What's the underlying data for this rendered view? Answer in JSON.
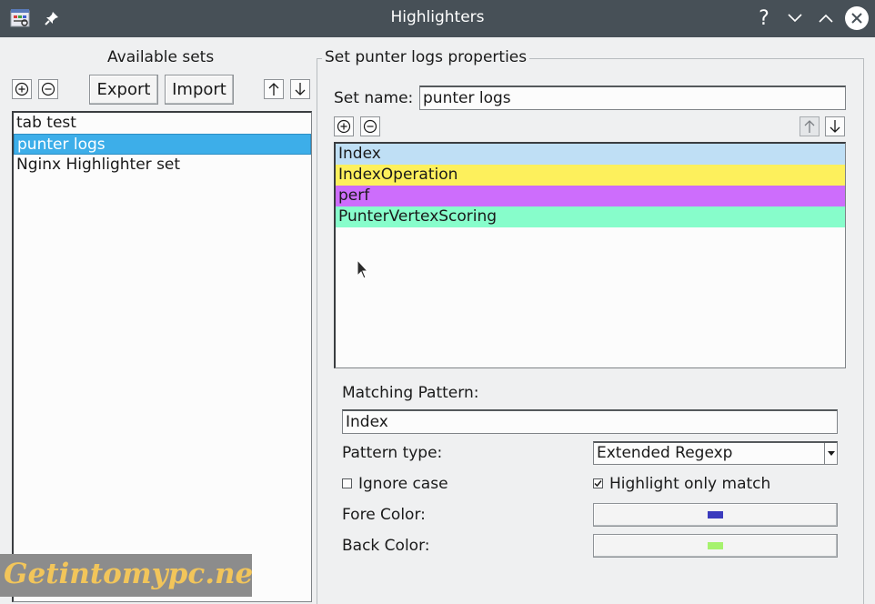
{
  "window": {
    "title": "Highlighters",
    "help_label": "?",
    "icons": [
      "app-icon",
      "pin-icon",
      "help-icon",
      "minimize-icon",
      "maximize-icon",
      "close-icon"
    ]
  },
  "left": {
    "heading": "Available sets",
    "export_label": "Export",
    "import_label": "Import",
    "sets": [
      {
        "label": "tab test",
        "selected": false
      },
      {
        "label": "punter logs",
        "selected": true
      },
      {
        "label": "Nginx Highlighter set",
        "selected": false
      }
    ]
  },
  "right": {
    "group_title": "Set punter logs properties",
    "set_name_label": "Set name:",
    "set_name_value": "punter logs",
    "highlighters": [
      {
        "label": "Index",
        "color": "#bfdff5"
      },
      {
        "label": "IndexOperation",
        "color": "#fdf05c"
      },
      {
        "label": "perf",
        "color": "#cd6dfc"
      },
      {
        "label": "PunterVertexScoring",
        "color": "#87fdcb"
      }
    ],
    "matching_pattern_label": "Matching Pattern:",
    "matching_pattern_value": "Index",
    "pattern_type_label": "Pattern type:",
    "pattern_type_value": "Extended Regexp",
    "ignore_case_label": "Ignore case",
    "ignore_case_checked": false,
    "highlight_only_match_label": "Highlight only match",
    "highlight_only_match_checked": true,
    "fore_color_label": "Fore Color:",
    "fore_color": "#3b3bbd",
    "back_color_label": "Back Color:",
    "back_color": "#a6f26e"
  },
  "colors": {
    "titlebar": "#475057",
    "selection": "#3daee9",
    "window_bg": "#eff0f1"
  },
  "watermark": "Getintomypc.net"
}
